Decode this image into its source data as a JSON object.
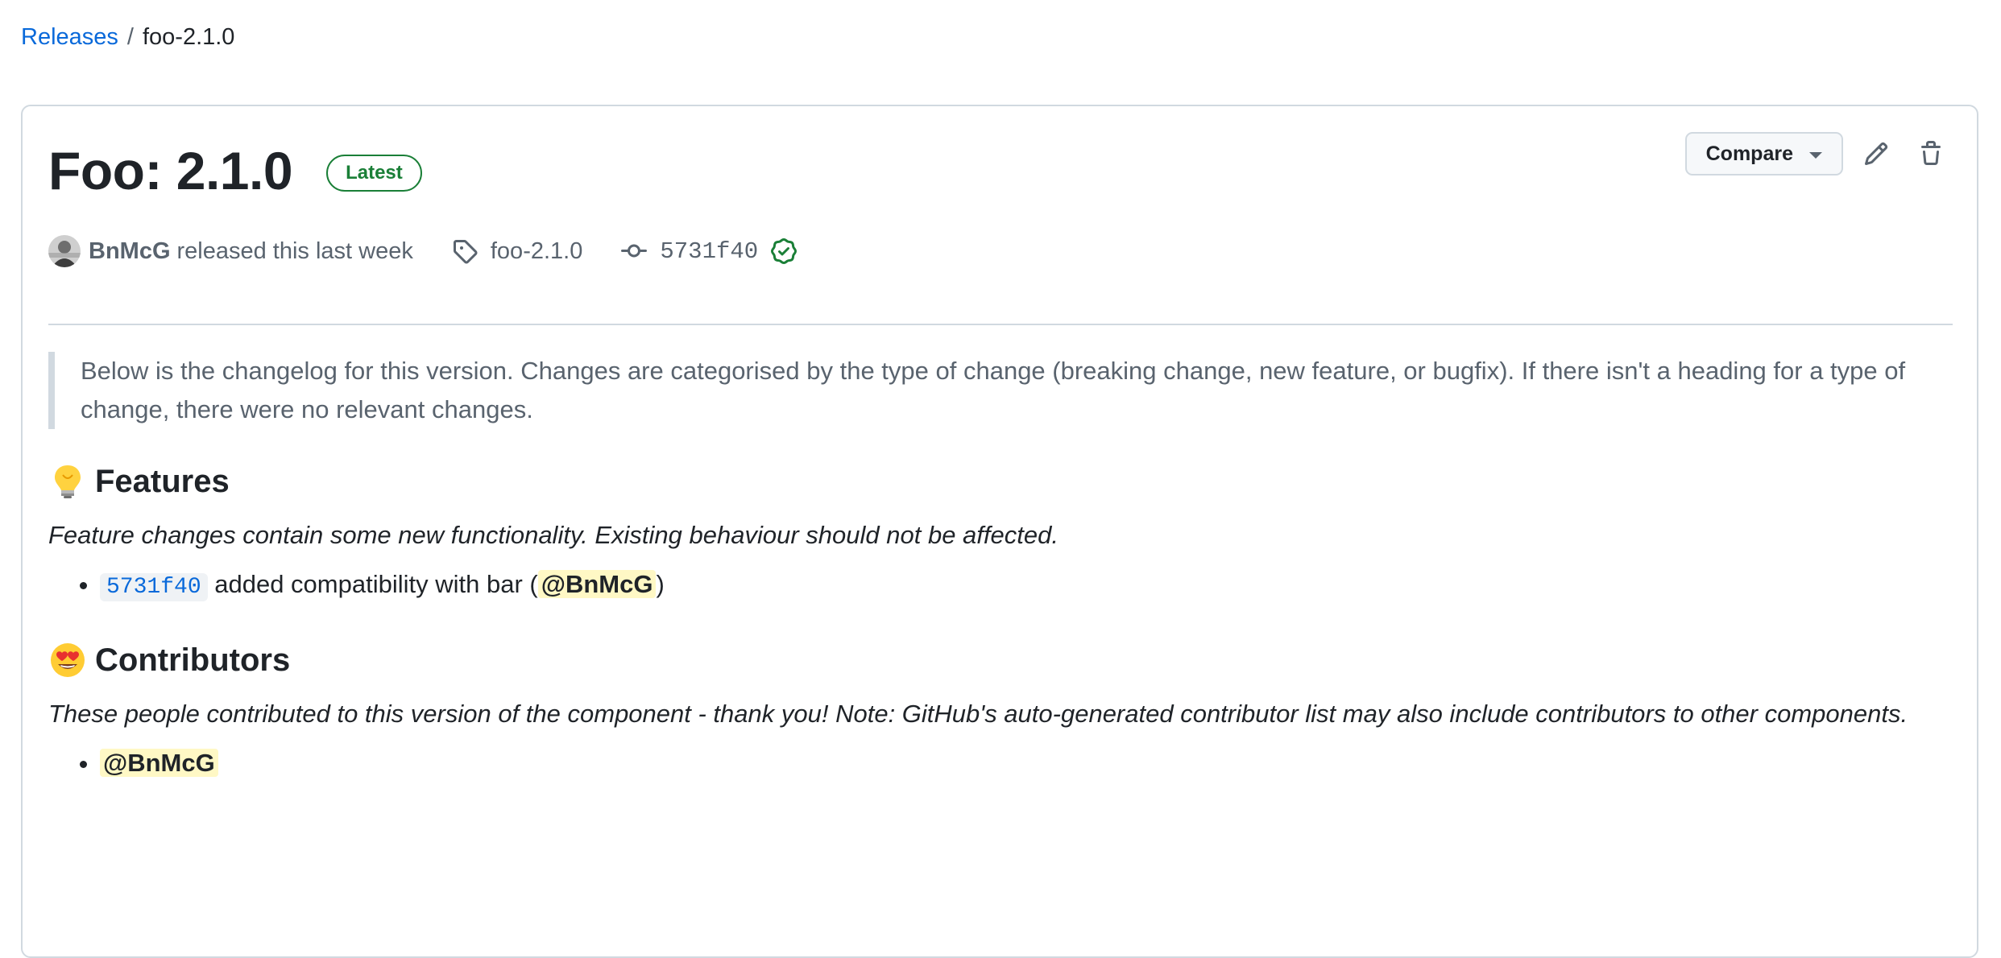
{
  "breadcrumb": {
    "releases_label": "Releases",
    "separator": "/",
    "current": "foo-2.1.0"
  },
  "release": {
    "title": "Foo: 2.1.0",
    "badge": "Latest",
    "compare_label": "Compare",
    "author": "BnMcG",
    "released_text": "released this last week",
    "tag": "foo-2.1.0",
    "commit": "5731f40"
  },
  "notes": {
    "intro": "Below is the changelog for this version. Changes are categorised by the type of change (breaking change, new feature, or bugfix). If there isn't a heading for a type of change, there were no relevant changes.",
    "features": {
      "heading": "Features",
      "emoji": "lightbulb",
      "description": "Feature changes contain some new functionality. Existing behaviour should not be affected.",
      "items": [
        {
          "commit": "5731f40",
          "text_before": " added compatibility with bar (",
          "mention": "@BnMcG",
          "text_after": ")"
        }
      ]
    },
    "contributors": {
      "heading": "Contributors",
      "emoji": "heart-eyes",
      "description": "These people contributed to this version of the component - thank you! Note: GitHub's auto-generated contributor list may also include contributors to other components.",
      "items": [
        {
          "mention": "@BnMcG"
        }
      ]
    }
  },
  "colors": {
    "link": "#0969da",
    "badge_green": "#1a7f37",
    "mention_bg": "#fff8c5",
    "muted": "#59636e"
  }
}
